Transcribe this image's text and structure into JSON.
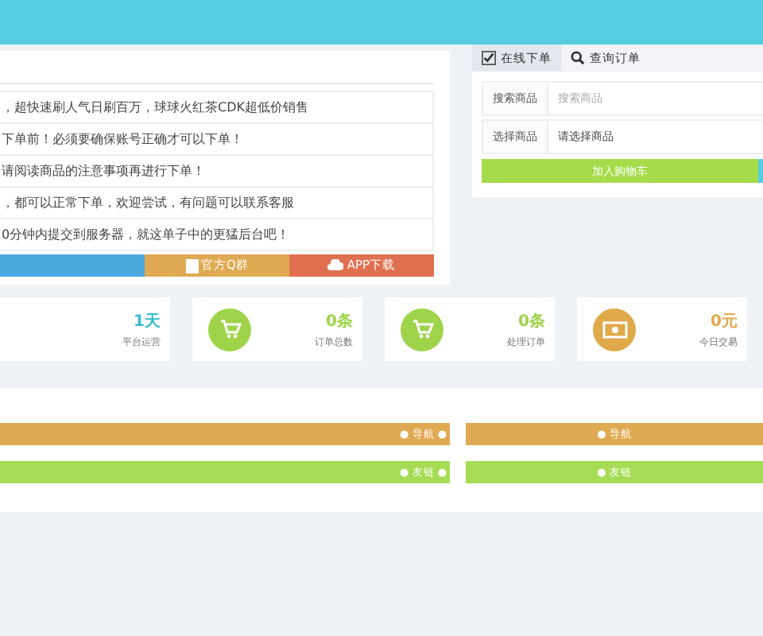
{
  "notices": [
    "，超快速刷人气日刷百万，球球火红茶CDK超低价销售",
    "下单前！必须要确保账号正确才可以下单！",
    "请阅读商品的注意事项再进行下单！",
    "，都可以正常下单，欢迎尝试，有问题可以联系客服",
    "0分钟内提交到服务器，就这单子中的更猛后台吧！"
  ],
  "notice_buttons": [
    {
      "color": "#4aa8dd"
    },
    {
      "label": "官方Q群",
      "color": "#e0aa52"
    },
    {
      "label": "APP下载",
      "color": "#e07050"
    }
  ],
  "order_panel": {
    "tabs": [
      {
        "label": "在线下单",
        "selected": true
      },
      {
        "label": "查询订单",
        "selected": false
      }
    ],
    "fields": [
      {
        "label": "搜索商品",
        "placeholder": "搜索商品"
      },
      {
        "label": "选择商品",
        "value": "请选择商品"
      }
    ],
    "submit": "加入购物车"
  },
  "stats": [
    {
      "value": "1天",
      "caption": "平台运营",
      "color": "#3bbcd0"
    },
    {
      "value": "0条",
      "caption": "订单总数",
      "color": "#9fd44a"
    },
    {
      "value": "0条",
      "caption": "处理订单",
      "color": "#9fd44a"
    },
    {
      "value": "0元",
      "caption": "今日交易",
      "color": "#e0a94a"
    }
  ],
  "links": [
    {
      "label": "● 导航 ●",
      "color": "#e0aa52"
    },
    {
      "label": "● 导航",
      "color": "#e0aa52"
    },
    {
      "label": "● 友链 ●",
      "color": "#a6dc55"
    },
    {
      "label": "● 友链",
      "color": "#a6dc55"
    }
  ]
}
